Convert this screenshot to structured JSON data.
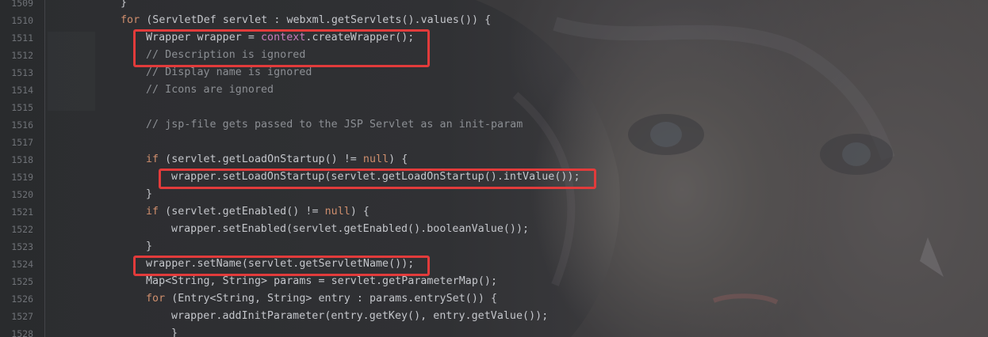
{
  "editor": {
    "lines": [
      {
        "number": "1509",
        "indent": 2,
        "tokens": [
          {
            "text": "}",
            "cls": "fn"
          }
        ]
      },
      {
        "number": "1510",
        "indent": 2,
        "tokens": [
          {
            "text": "for",
            "cls": "kw"
          },
          {
            "text": " (ServletDef servlet : webxml.getServlets().values()) {",
            "cls": "fn"
          }
        ]
      },
      {
        "number": "1511",
        "indent": 3,
        "tokens": [
          {
            "text": "Wrapper wrapper = ",
            "cls": "fn"
          },
          {
            "text": "context",
            "cls": "fld"
          },
          {
            "text": ".createWrapper();",
            "cls": "fn"
          }
        ]
      },
      {
        "number": "1512",
        "indent": 3,
        "tokens": [
          {
            "text": "// Description is ignored",
            "cls": "cmt"
          }
        ]
      },
      {
        "number": "1513",
        "indent": 3,
        "tokens": [
          {
            "text": "// Display name is ignored",
            "cls": "cmt"
          }
        ]
      },
      {
        "number": "1514",
        "indent": 3,
        "tokens": [
          {
            "text": "// Icons are ignored",
            "cls": "cmt"
          }
        ]
      },
      {
        "number": "1515",
        "indent": 3,
        "tokens": []
      },
      {
        "number": "1516",
        "indent": 3,
        "tokens": [
          {
            "text": "// jsp-file gets passed to the JSP Servlet as an init-param",
            "cls": "cmt"
          }
        ]
      },
      {
        "number": "1517",
        "indent": 3,
        "tokens": []
      },
      {
        "number": "1518",
        "indent": 3,
        "tokens": [
          {
            "text": "if",
            "cls": "kw"
          },
          {
            "text": " (servlet.getLoadOnStartup() != ",
            "cls": "fn"
          },
          {
            "text": "null",
            "cls": "kw"
          },
          {
            "text": ") {",
            "cls": "fn"
          }
        ]
      },
      {
        "number": "1519",
        "indent": 4,
        "tokens": [
          {
            "text": "wrapper.setLoadOnStartup(servlet.getLoadOnStartup().intValue());",
            "cls": "fn"
          }
        ]
      },
      {
        "number": "1520",
        "indent": 3,
        "tokens": [
          {
            "text": "}",
            "cls": "fn"
          }
        ]
      },
      {
        "number": "1521",
        "indent": 3,
        "tokens": [
          {
            "text": "if",
            "cls": "kw"
          },
          {
            "text": " (servlet.getEnabled() != ",
            "cls": "fn"
          },
          {
            "text": "null",
            "cls": "kw"
          },
          {
            "text": ") {",
            "cls": "fn"
          }
        ]
      },
      {
        "number": "1522",
        "indent": 4,
        "tokens": [
          {
            "text": "wrapper.setEnabled(servlet.getEnabled().booleanValue());",
            "cls": "fn"
          }
        ]
      },
      {
        "number": "1523",
        "indent": 3,
        "tokens": [
          {
            "text": "}",
            "cls": "fn"
          }
        ]
      },
      {
        "number": "1524",
        "indent": 3,
        "tokens": [
          {
            "text": "wrapper.setName(servlet.getServletName());",
            "cls": "fn"
          }
        ]
      },
      {
        "number": "1525",
        "indent": 3,
        "tokens": [
          {
            "text": "Map<String, String> params = servlet.getParameterMap();",
            "cls": "fn"
          }
        ]
      },
      {
        "number": "1526",
        "indent": 3,
        "tokens": [
          {
            "text": "for",
            "cls": "kw"
          },
          {
            "text": " (Entry<String, String> entry : params.entrySet()) {",
            "cls": "fn"
          }
        ]
      },
      {
        "number": "1527",
        "indent": 4,
        "tokens": [
          {
            "text": "wrapper.addInitParameter(entry.getKey(), entry.getValue());",
            "cls": "fn"
          }
        ]
      },
      {
        "number": "1528",
        "indent": 4,
        "tokens": [
          {
            "text": "}",
            "cls": "fn"
          }
        ]
      }
    ],
    "highlights": [
      {
        "label": "create-wrapper-highlight",
        "from_line": 1511,
        "to_line": 1512
      },
      {
        "label": "set-load-on-startup-highlight",
        "from_line": 1519,
        "to_line": 1519
      },
      {
        "label": "set-name-highlight",
        "from_line": 1524,
        "to_line": 1524
      }
    ],
    "colors": {
      "background": "#2b2c2f",
      "keyword": "#cf8e6d",
      "comment": "#8c8f94",
      "field": "#c77dbb",
      "text": "#c4c6cb",
      "line_number": "#6f7277",
      "highlight_box": "#e23b3b"
    }
  }
}
